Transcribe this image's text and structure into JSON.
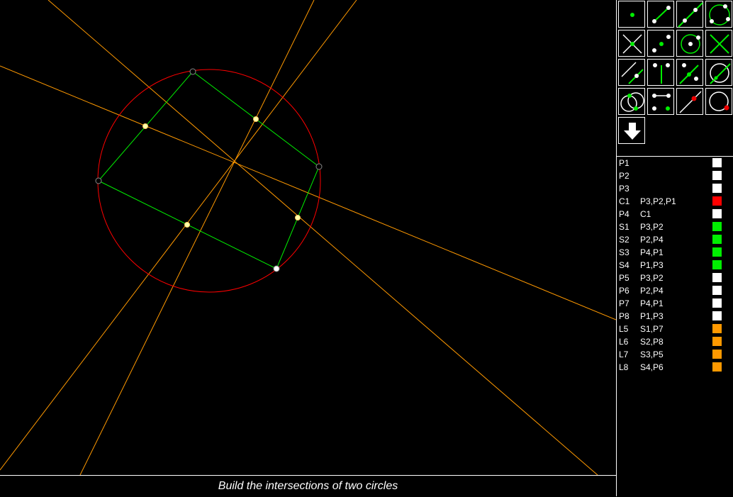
{
  "status_message": "Build the intersections of two circles",
  "tools": [
    {
      "name": "tool-point"
    },
    {
      "name": "tool-segment"
    },
    {
      "name": "tool-line"
    },
    {
      "name": "tool-circle-three-points"
    },
    {
      "name": "tool-intersection-lines"
    },
    {
      "name": "tool-midpoint"
    },
    {
      "name": "tool-circle-center-point"
    },
    {
      "name": "tool-perpendicular"
    },
    {
      "name": "tool-parallel"
    },
    {
      "name": "tool-perpendicular-bisector"
    },
    {
      "name": "tool-angle-bisector"
    },
    {
      "name": "tool-tangent"
    },
    {
      "name": "tool-circle-circle-intersection"
    },
    {
      "name": "tool-compass"
    },
    {
      "name": "tool-line-point-intersection"
    },
    {
      "name": "tool-circle-point"
    },
    {
      "name": "tool-move-down"
    }
  ],
  "objects": [
    {
      "name": "P1",
      "parents": "",
      "color": "#ffffff"
    },
    {
      "name": "P2",
      "parents": "",
      "color": "#ffffff"
    },
    {
      "name": "P3",
      "parents": "",
      "color": "#ffffff"
    },
    {
      "name": "C1",
      "parents": "P3,P2,P1",
      "color": "#ff0000"
    },
    {
      "name": "P4",
      "parents": "C1",
      "color": "#ffffff"
    },
    {
      "name": "S1",
      "parents": "P3,P2",
      "color": "#00ee00"
    },
    {
      "name": "S2",
      "parents": "P2,P4",
      "color": "#00ee00"
    },
    {
      "name": "S3",
      "parents": "P4,P1",
      "color": "#00ee00"
    },
    {
      "name": "S4",
      "parents": "P1,P3",
      "color": "#00ee00"
    },
    {
      "name": "P5",
      "parents": "P3,P2",
      "color": "#ffffff"
    },
    {
      "name": "P6",
      "parents": "P2,P4",
      "color": "#ffffff"
    },
    {
      "name": "P7",
      "parents": "P4,P1",
      "color": "#ffffff"
    },
    {
      "name": "P8",
      "parents": "P1,P3",
      "color": "#ffffff"
    },
    {
      "name": "L5",
      "parents": "S1,P7",
      "color": "#ff9900"
    },
    {
      "name": "L6",
      "parents": "S2,P8",
      "color": "#ff9900"
    },
    {
      "name": "L7",
      "parents": "S3,P5",
      "color": "#ff9900"
    },
    {
      "name": "L8",
      "parents": "S4,P6",
      "color": "#ff9900"
    }
  ],
  "colors": {
    "background": "#000000",
    "circle": "#ff0000",
    "segment": "#00ee00",
    "line": "#ff9900",
    "point": "#ffffff",
    "midpoint_fill": "#ffffaa"
  }
}
